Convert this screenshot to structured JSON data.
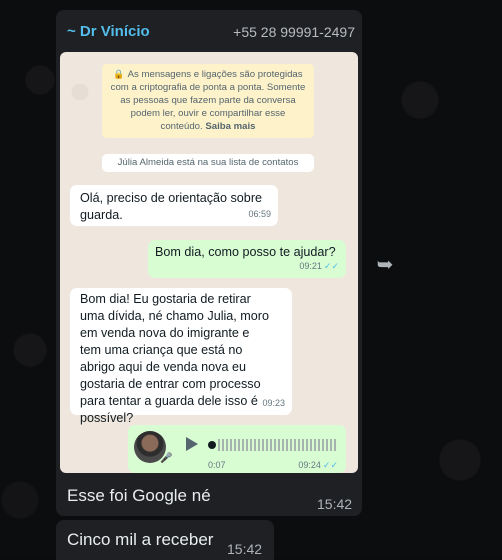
{
  "chat_bg_color": "#0c0d0f",
  "message": {
    "sender_name": "~ Dr Vinício",
    "sender_phone": "+55 28 99991-2497",
    "screenshot": {
      "encryption_notice": "As mensagens e ligações são protegidas com a criptografia de ponta a ponta. Somente as pessoas que fazem parte da conversa podem ler, ouvir e compartilhar esse conteúdo.",
      "encryption_link": "Saiba mais",
      "contact_note": "Júlia Almeida está na sua lista de contatos",
      "messages": [
        {
          "direction": "in",
          "text": "Olá, preciso de orientação sobre guarda.",
          "time": "06:59"
        },
        {
          "direction": "out",
          "text": "Bom dia, como posso te ajudar?",
          "time": "09:21",
          "status": "read"
        },
        {
          "direction": "in",
          "text": "Bom dia! Eu gostaria de retirar uma dívida, né chamo Julia, moro em venda nova do imigrante e tem uma criança que está no abrigo aqui de venda nova eu gostaria de entrar com processo para tentar a guarda dele isso é possível?",
          "time": "09:23"
        }
      ],
      "audio": {
        "duration": "0:07",
        "time": "09:24",
        "status": "read"
      }
    },
    "caption": "Esse foi Google né",
    "caption_time": "15:42"
  },
  "next_message": {
    "text": "Cinco mil a receber",
    "time": "15:42"
  },
  "icons": {
    "lock": "lock-icon",
    "forward": "forward-icon",
    "play": "play-icon",
    "mic": "mic-icon",
    "read_ticks": "double-check-icon"
  },
  "colors": {
    "sender": "#53bdeb",
    "bubble_dark": "#1f2023",
    "bubble_out": "#d9fdd3",
    "bubble_in": "#ffffff"
  }
}
